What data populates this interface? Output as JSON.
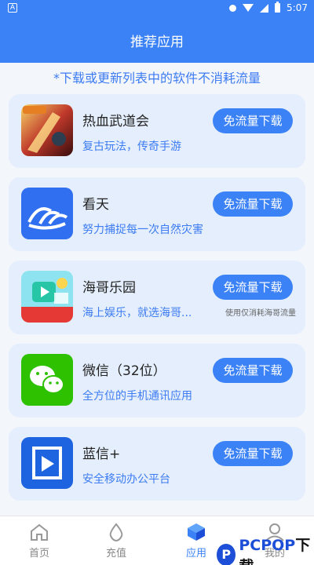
{
  "status_bar": {
    "left_badge": "A",
    "time": "5:07"
  },
  "header": {
    "title": "推荐应用"
  },
  "notice": "*下载或更新列表中的软件不消耗流量",
  "apps": [
    {
      "name": "热血武道会",
      "desc": "复古玩法，传奇手游",
      "button": "免流量下载",
      "note": ""
    },
    {
      "name": "看天",
      "desc": "努力捕捉每一次自然灾害",
      "button": "免流量下载",
      "note": ""
    },
    {
      "name": "海哥乐园",
      "desc": "海上娱乐，就选海哥...",
      "button": "免流量下载",
      "note": "使用仅消耗海哥流量"
    },
    {
      "name": "微信（32位）",
      "desc": "全方位的手机通讯应用",
      "button": "免流量下载",
      "note": ""
    },
    {
      "name": "蓝信+",
      "desc": "安全移动办公平台",
      "button": "免流量下载",
      "note": ""
    }
  ],
  "tabs": [
    {
      "label": "首页",
      "icon": "home-icon"
    },
    {
      "label": "充值",
      "icon": "drop-icon"
    },
    {
      "label": "应用",
      "icon": "cube-icon"
    },
    {
      "label": "我的",
      "icon": "user-icon"
    }
  ],
  "watermark": {
    "brand": "PCPOP",
    "suffix": "下载",
    "badge": "P"
  },
  "colors": {
    "primary": "#3b82f6",
    "card": "#e4eefc",
    "accent_text": "#3d7cf2"
  }
}
